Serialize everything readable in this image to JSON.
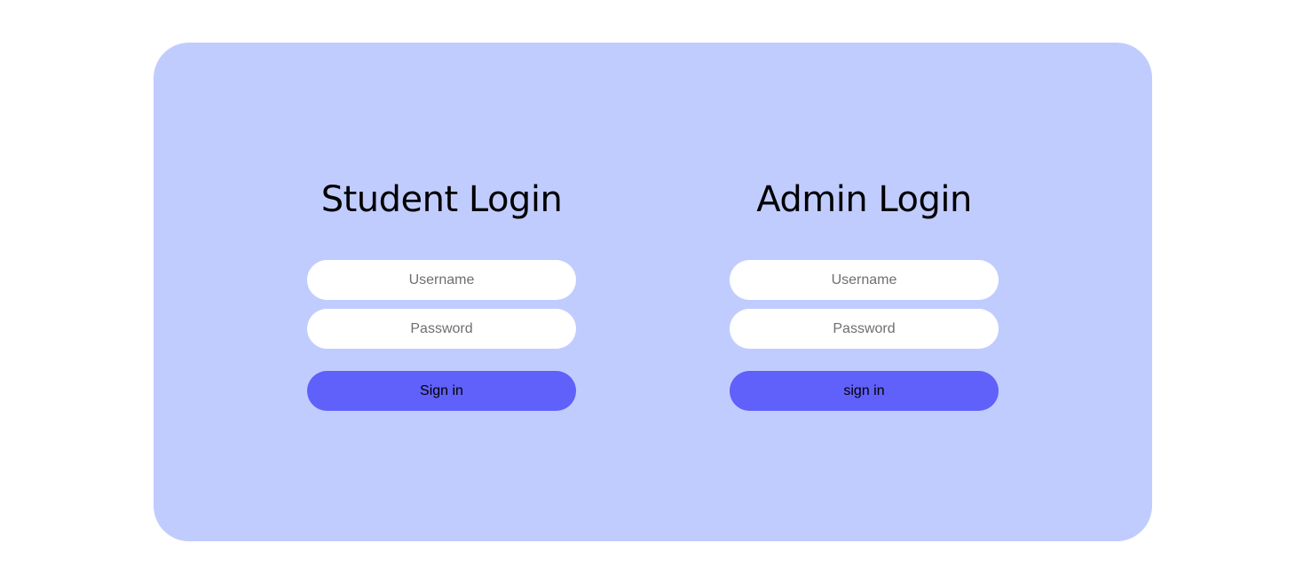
{
  "colors": {
    "page_background": "#ffffff",
    "card_background": "#c1ccfe",
    "input_background": "#ffffff",
    "button_background": "#6060fa",
    "button_text": "#000000",
    "title_text": "#000000"
  },
  "student": {
    "title": "Student Login",
    "username_placeholder": "Username",
    "password_placeholder": "Password",
    "submit_label": "Sign in"
  },
  "admin": {
    "title": "Admin Login",
    "username_placeholder": "Username",
    "password_placeholder": "Password",
    "submit_label": "sign in"
  }
}
